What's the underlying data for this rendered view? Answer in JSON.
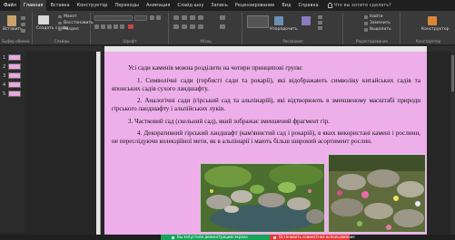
{
  "menu": {
    "items": [
      "Файл",
      "Главная",
      "Вставка",
      "Конструктор",
      "Переходы",
      "Анимация",
      "Слайд-шоу",
      "Запись",
      "Рецензирование",
      "Вид",
      "Справка"
    ],
    "tell_me": "Что вы хотите сделать?"
  },
  "ribbon": {
    "paste": "Вставить",
    "clipboard_label": "Буфер обмена",
    "new_slide": "Создать слайд",
    "layout": "Макет",
    "reset": "Восстановить",
    "section": "Раздел",
    "slides_label": "Слайды",
    "font_label": "Шрифт",
    "paragraph_label": "Абзац",
    "arrange": "Упорядочить",
    "drawing_label": "Рисование",
    "find": "Найти",
    "replace": "Заменить",
    "select": "Выделить",
    "editing_label": "Редактирование",
    "designer": "Конструктор",
    "designer_label": "Конструктор"
  },
  "thumbnails": [
    "1",
    "2",
    "3",
    "4",
    "5"
  ],
  "slide": {
    "p0": "Усі сади каменів можна розділити на чотири принципові групи:",
    "p1": "1. Символічні сади (горбисті сади та рокарії), які відображають символіку китайських садів та японських садів сухого ландшафту.",
    "p2": "2. Аналогічні сади (гірський сад та альпінарій), які відтворюють в зменшеному масштабі природи гірського ландшафту і альпійських луків.",
    "p3": "3. Частковий сад (скельний сад), який зображає зменшений фрагмент гір.",
    "p4": "4. Декоративний гірський ландшафт (кам'янистий сад і рокарій), в яких використані камені і рослини, не переслідуючи колекційної мети, як в альпінарії і мають більш широкий асортимент рослин."
  },
  "status": {
    "presenting": "Вы запустили демонстрацию экрана",
    "stop": "Остановить совместное использование"
  },
  "colors": {
    "slide_bg": "#eeaeea",
    "notice_green": "#16a45a",
    "notice_red": "#e23b3b"
  }
}
